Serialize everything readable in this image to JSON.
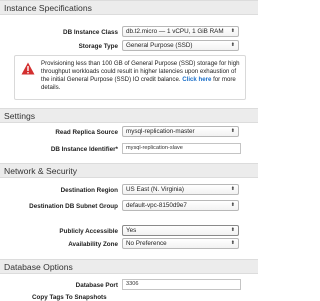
{
  "sections": {
    "instance_specifications": "Instance Specifications",
    "settings": "Settings",
    "network_security": "Network & Security",
    "database_options": "Database Options"
  },
  "fields": {
    "db_instance_class": {
      "label": "DB Instance Class",
      "value": "db.t2.micro — 1 vCPU, 1 GiB RAM"
    },
    "storage_type": {
      "label": "Storage Type",
      "value": "General Purpose (SSD)"
    },
    "read_replica_source": {
      "label": "Read Replica Source",
      "value": "mysql-replication-master"
    },
    "db_instance_identifier": {
      "label": "DB Instance Identifier*",
      "value": "mysql-replication-slave"
    },
    "destination_region": {
      "label": "Destination Region",
      "value": "US East (N. Virginia)"
    },
    "destination_db_subnet_group": {
      "label": "Destination DB Subnet Group",
      "value": "default-vpc-8150d9e7"
    },
    "publicly_accessible": {
      "label": "Publicly Accessible",
      "value": "Yes"
    },
    "availability_zone": {
      "label": "Availability Zone",
      "value": "No Preference"
    },
    "database_port": {
      "label": "Database Port",
      "value": "3306"
    },
    "copy_tags_partial": "Copy Tags To Snapshots"
  },
  "warning": {
    "text": "Provisioning less than 100 GB of General Purpose (SSD) storage for high throughput workloads could result in higher latencies upon exhaustion of the initial General Purpose (SSD) IO credit balance.",
    "link": "Click here",
    "suffix": "for more details."
  },
  "colors": {
    "warning_red": "#d32f2f",
    "link_blue": "#1a6fc9"
  },
  "icons": {
    "warning": "warning-triangle-icon",
    "select": "chevron-updown-icon"
  }
}
